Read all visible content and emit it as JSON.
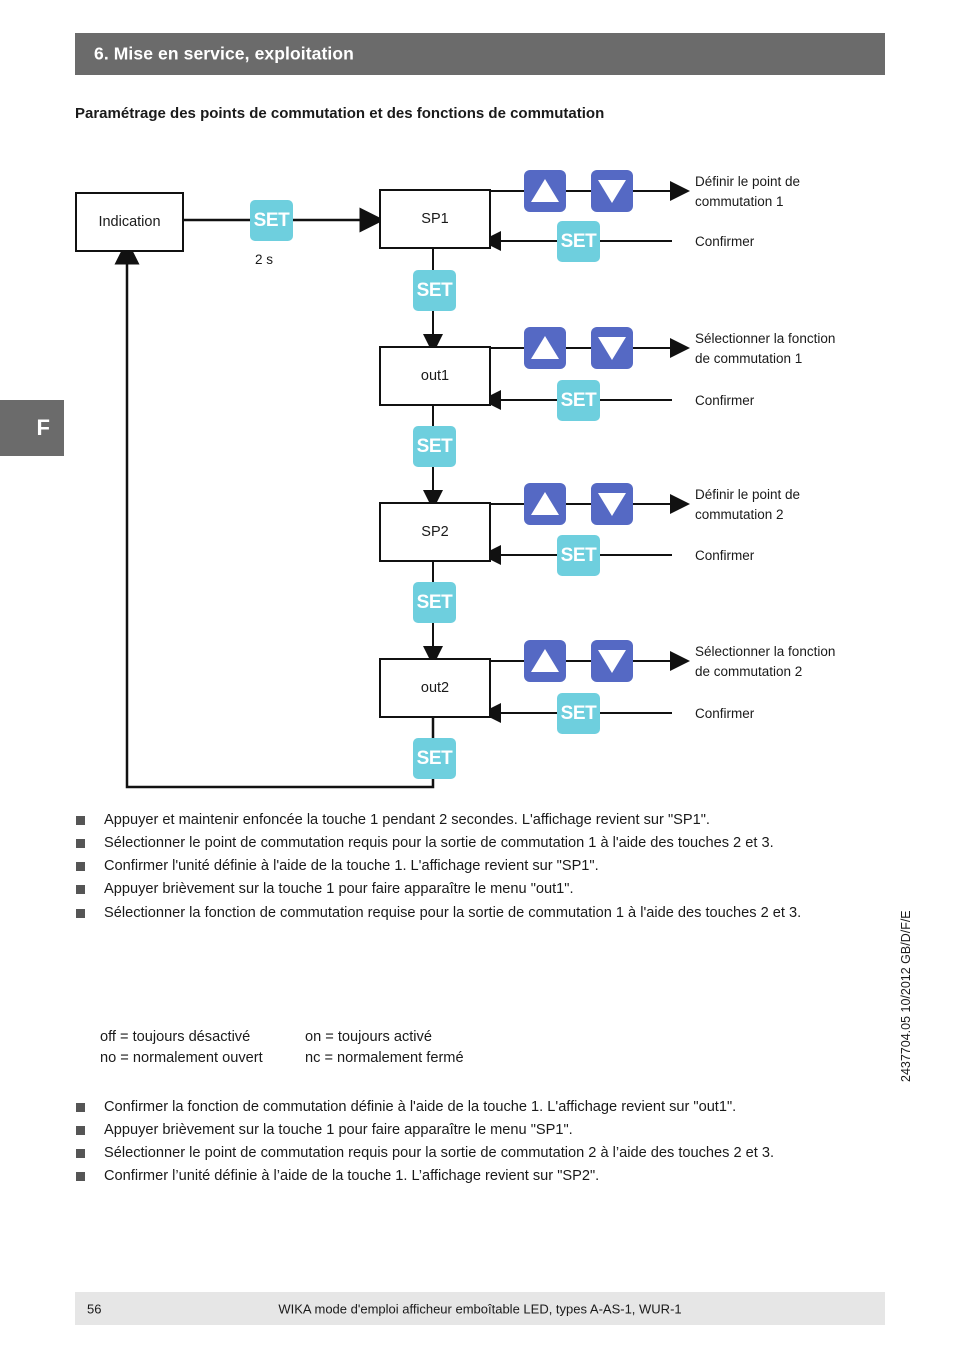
{
  "header": {
    "chapter_title": "6. Mise en service, exploitation",
    "subtitle": "Paramétrage des points de commutation et des fonctions de commutation",
    "chapter_tab_letter": "F"
  },
  "colors": {
    "header_bar": "#6b6b6b",
    "set_button": "#6ecfde",
    "arrow_button": "#5569c4",
    "footer_bar": "#e6e6e6"
  },
  "diagram": {
    "nodes": {
      "indication": "Indication",
      "sp1": "SP1",
      "out1": "out1",
      "sp2": "SP2",
      "out2": "out2"
    },
    "set_label": "SET",
    "hold_time": "2 s",
    "rows": [
      {
        "set_action": "Définir le point de\ncommutation 1",
        "confirm": "Confirmer"
      },
      {
        "set_action": "Sélectionner la fonction\nde commutation 1",
        "confirm": "Confirmer"
      },
      {
        "set_action": "Définir le point de\ncommutation 2",
        "confirm": "Confirmer"
      },
      {
        "set_action": "Sélectionner la fonction\nde commutation 2",
        "confirm": "Confirmer"
      }
    ],
    "labels": {
      "r1_line1": "Définir le point de",
      "r1_line2": "commutation 1",
      "r1_confirm": "Confirmer",
      "r2_line1": "Sélectionner la fonction",
      "r2_line2": "de commutation 1",
      "r2_confirm": "Confirmer",
      "r3_line1": "Définir le point de",
      "r3_line2": "commutation 2",
      "r3_confirm": "Confirmer",
      "r4_line1": "Sélectionner la fonction",
      "r4_line2": "de commutation 2",
      "r4_confirm": "Confirmer"
    }
  },
  "instructions_part1": [
    "Appuyer et maintenir enfoncée la touche 1 pendant 2 secondes. L'affichage revient sur \"SP1\".",
    "Sélectionner le point de commutation requis pour la sortie de commutation 1 à l'aide des touches 2 et 3.",
    "Confirmer l'unité définie à l'aide de la touche 1. L'affichage revient sur \"SP1\".",
    "Appuyer brièvement sur la touche 1 pour faire apparaître le menu \"out1\".",
    "Sélectionner la fonction de commutation requise pour la sortie de commutation 1 à l'aide des touches 2 et 3."
  ],
  "definitions": [
    {
      "left": "off = toujours désactivé",
      "right": "on = toujours activé"
    },
    {
      "left": "no = normalement ouvert",
      "right": "nc = normalement fermé"
    }
  ],
  "instructions_part2": [
    "Confirmer la fonction de commutation définie à l'aide de la touche 1. L'affichage revient sur \"out1\".",
    "Appuyer brièvement sur la touche 1 pour faire apparaître le menu \"SP1\".",
    "Sélectionner le point de commutation requis pour la sortie de commutation 2 à l’aide des touches 2 et 3.",
    "Confirmer l’unité définie à l’aide de la touche 1. L’affichage revient sur \"SP2\"."
  ],
  "footer": {
    "page_number": "56",
    "document_line": "WIKA mode d'emploi afficheur emboîtable LED, types A-AS-1, WUR-1",
    "side_code": "2437704.05 10/2012 GB/D/F/E"
  }
}
